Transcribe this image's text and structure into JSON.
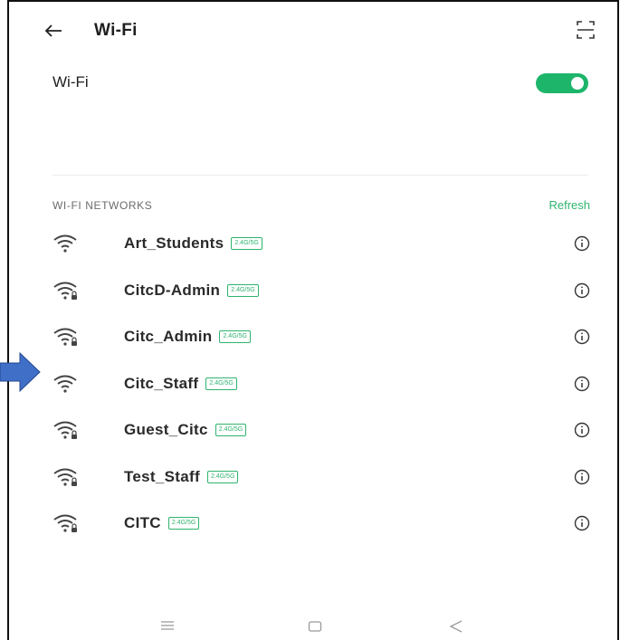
{
  "header": {
    "title": "Wi-Fi",
    "back_icon": "arrow-left-icon",
    "scan_icon": "qr-scan-icon"
  },
  "wifi_toggle": {
    "label": "Wi-Fi",
    "enabled": true,
    "color": "#1db56a"
  },
  "section": {
    "title": "WI-FI NETWORKS",
    "refresh_label": "Refresh",
    "accent": "#2fb46e"
  },
  "networks": [
    {
      "name": "Art_Students",
      "band": "2.4G/5G",
      "secured": false
    },
    {
      "name": "CitcD-Admin",
      "band": "2.4G/5G",
      "secured": true
    },
    {
      "name": "Citc_Admin",
      "band": "2.4G/5G",
      "secured": true
    },
    {
      "name": "Citc_Staff",
      "band": "2.4G/5G",
      "secured": false
    },
    {
      "name": "Guest_Citc",
      "band": "2.4G/5G",
      "secured": true
    },
    {
      "name": "Test_Staff",
      "band": "2.4G/5G",
      "secured": true
    },
    {
      "name": "CITC",
      "band": "2.4G/5G",
      "secured": true
    }
  ],
  "annotation": {
    "icon": "pointer-arrow-icon",
    "color": "#3f6fc7"
  },
  "navbar": {
    "icons": [
      "menu-icon",
      "home-icon",
      "back-triangle-icon"
    ]
  }
}
